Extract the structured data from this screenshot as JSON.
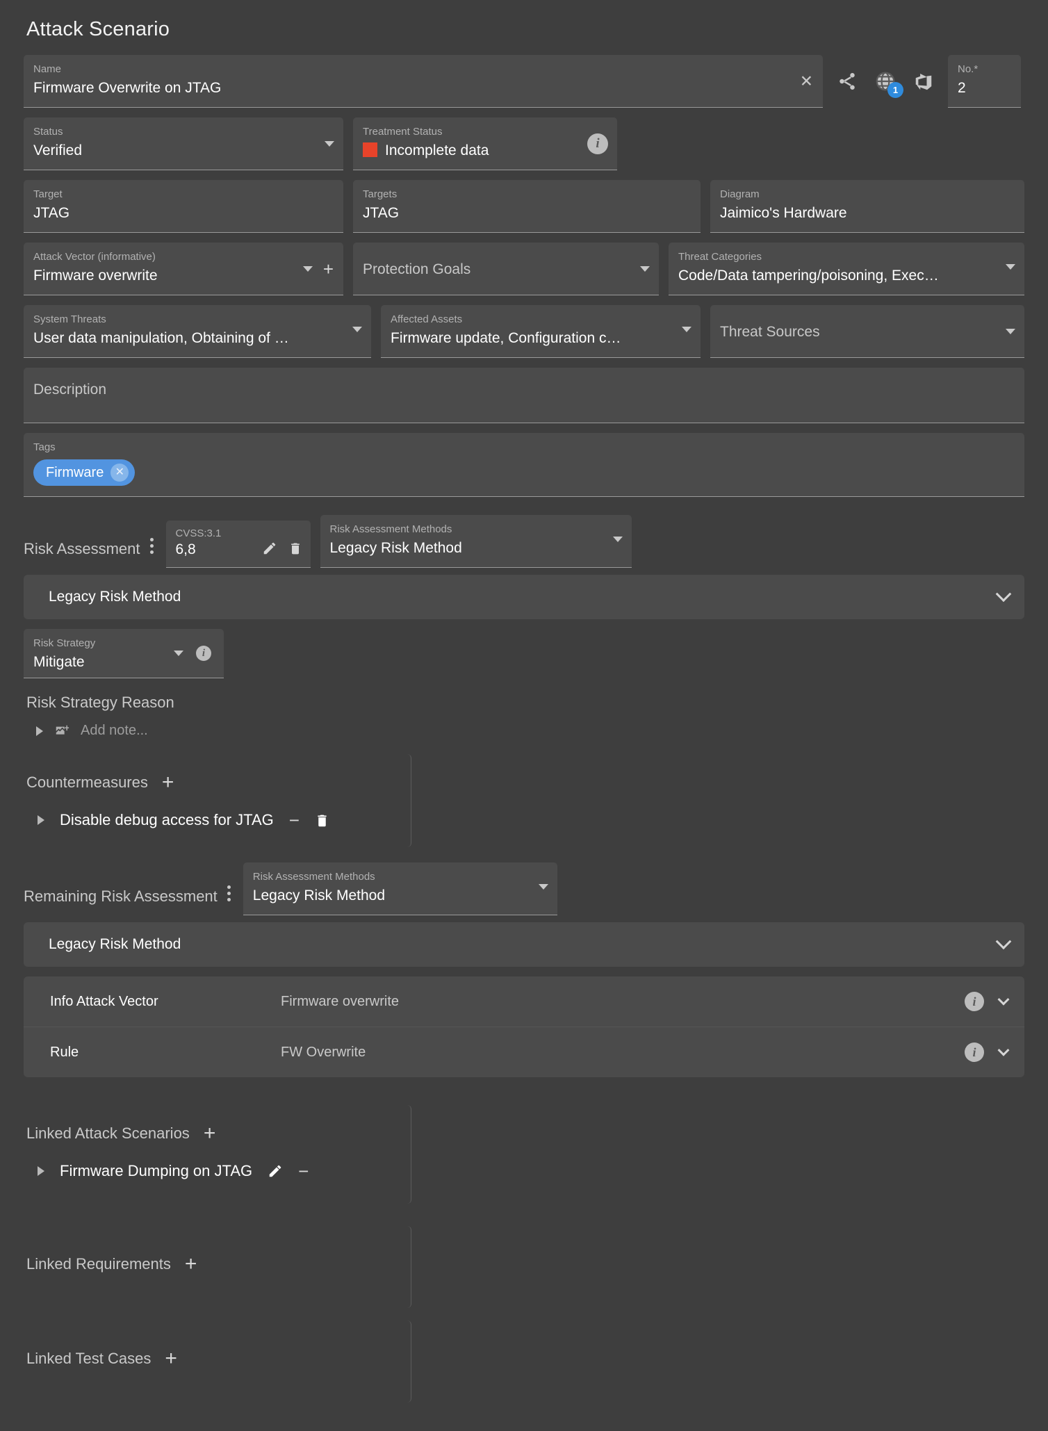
{
  "page_title": "Attack Scenario",
  "name_field": {
    "label": "Name",
    "value": "Firmware Overwrite on JTAG",
    "clear_icon": "close-icon"
  },
  "header_icons": {
    "share": "share-nodes-icon",
    "globe": "globe-icon",
    "globe_badge": "1",
    "devops": "azure-devops-icon"
  },
  "no_field": {
    "label": "No.*",
    "value": "2"
  },
  "status": {
    "label": "Status",
    "value": "Verified"
  },
  "treatment_status": {
    "label": "Treatment Status",
    "value": "Incomplete data",
    "swatch_color": "#e8432a",
    "info_icon": "info-icon"
  },
  "target": {
    "label": "Target",
    "value": "JTAG"
  },
  "targets": {
    "label": "Targets",
    "value": "JTAG"
  },
  "diagram": {
    "label": "Diagram",
    "value": "Jaimico's Hardware"
  },
  "attack_vector": {
    "label": "Attack Vector (informative)",
    "value": "Firmware overwrite",
    "add_icon": "plus-icon"
  },
  "protection_goals": {
    "placeholder": "Protection Goals"
  },
  "threat_categories": {
    "label": "Threat Categories",
    "value": "Code/Data tampering/poisoning, Exec…"
  },
  "system_threats": {
    "label": "System Threats",
    "value": "User data manipulation, Obtaining of …"
  },
  "affected_assets": {
    "label": "Affected Assets",
    "value": "Firmware update, Configuration c…"
  },
  "threat_sources": {
    "placeholder": "Threat Sources"
  },
  "description": {
    "placeholder": "Description"
  },
  "tags": {
    "label": "Tags",
    "chips": [
      {
        "label": "Firmware",
        "remove_icon": "close-icon"
      }
    ]
  },
  "risk_assessment": {
    "title": "Risk Assessment",
    "menu_icon": "kebab-menu-icon",
    "cvss": {
      "label": "CVSS:3.1",
      "value": "6,8",
      "edit_icon": "pencil-icon",
      "delete_icon": "trash-icon"
    },
    "methods": {
      "label": "Risk Assessment Methods",
      "value": "Legacy Risk Method"
    },
    "expander": {
      "label": "Legacy Risk Method",
      "chevron": "chevron-down-icon"
    }
  },
  "risk_strategy": {
    "label": "Risk Strategy",
    "value": "Mitigate",
    "info_icon": "info-icon"
  },
  "risk_strategy_reason": {
    "title": "Risk Strategy Reason",
    "note_placeholder": "Add note...",
    "note_icon": "add-image-icon",
    "expand_icon": "triangle-right-icon"
  },
  "countermeasures": {
    "title": "Countermeasures",
    "add_icon": "plus-icon",
    "items": [
      {
        "label": "Disable debug access for JTAG",
        "expand_icon": "triangle-right-icon",
        "minus_icon": "minus-icon",
        "delete_icon": "trash-icon"
      }
    ]
  },
  "remaining_risk_assessment": {
    "title": "Remaining Risk Assessment",
    "menu_icon": "kebab-menu-icon",
    "methods": {
      "label": "Risk Assessment Methods",
      "value": "Legacy Risk Method"
    },
    "expander": {
      "label": "Legacy Risk Method",
      "chevron": "chevron-down-icon"
    },
    "rows": [
      {
        "key": "Info Attack Vector",
        "value": "Firmware overwrite",
        "info_icon": "info-icon",
        "chevron": "chevron-down-icon"
      },
      {
        "key": "Rule",
        "value": "FW Overwrite",
        "info_icon": "info-icon",
        "chevron": "chevron-down-icon"
      }
    ]
  },
  "linked_attack_scenarios": {
    "title": "Linked Attack Scenarios",
    "add_icon": "plus-icon",
    "items": [
      {
        "label": "Firmware Dumping on JTAG",
        "expand_icon": "triangle-right-icon",
        "edit_icon": "pencil-icon",
        "minus_icon": "minus-icon"
      }
    ]
  },
  "linked_requirements": {
    "title": "Linked Requirements",
    "add_icon": "plus-icon"
  },
  "linked_test_cases": {
    "title": "Linked Test Cases",
    "add_icon": "plus-icon"
  }
}
